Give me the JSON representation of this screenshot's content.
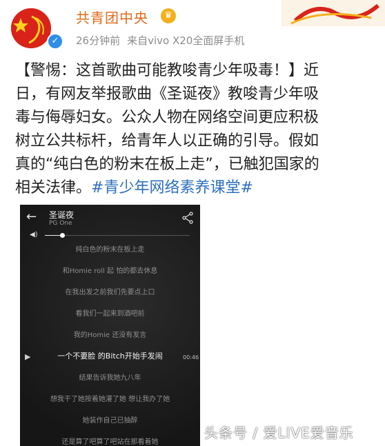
{
  "post": {
    "author": "共青团中央",
    "time": "26分钟前",
    "source": "来自vivo X20全面屏手机",
    "body_lines": [
      "【警惕：这首歌曲可能教唆青少年吸毒！】近",
      "日，有网友举报歌曲《圣诞夜》教唆青少年吸",
      "毒与侮辱妇女。公众人物在网络空间更应积极",
      "树立公共标杆，给青年人以正确的引导。假如",
      "真的“纯白色的粉末在板上走”，已触犯国家的"
    ],
    "body_last_prefix": "相关法律。",
    "hashtag": "#青少年网络素养课堂#"
  },
  "player": {
    "song_title": "圣诞夜",
    "artist": "PG One",
    "volume_level": 0.12,
    "current_time": "00:46",
    "lyrics": [
      "纯白色的粉末在板上走",
      "和Homie roll 起 怕的都去休息",
      "在我出发之前我们先要点上口",
      "看我们一起来到酒吧前",
      "我的Homie 还没有发言",
      "一个不要脸 的Bitch开始手发闹",
      "结果告诉我她九八年",
      "想我干了她按着她灌了她 想让我办了她",
      "她装作自己已抽醉",
      "还是算了吧算了吧站在那看着她"
    ],
    "current_index": 5
  },
  "watermark": "头条号 / 爱LIVE爱音乐",
  "colors": {
    "author": "#e26a1b",
    "hashtag": "#2d6fbd",
    "verified": "#2f8ee8"
  },
  "icons": [
    "verified-icon",
    "vip-badge-icon",
    "back-arrow-icon",
    "share-icon",
    "volume-icon",
    "play-icon"
  ]
}
